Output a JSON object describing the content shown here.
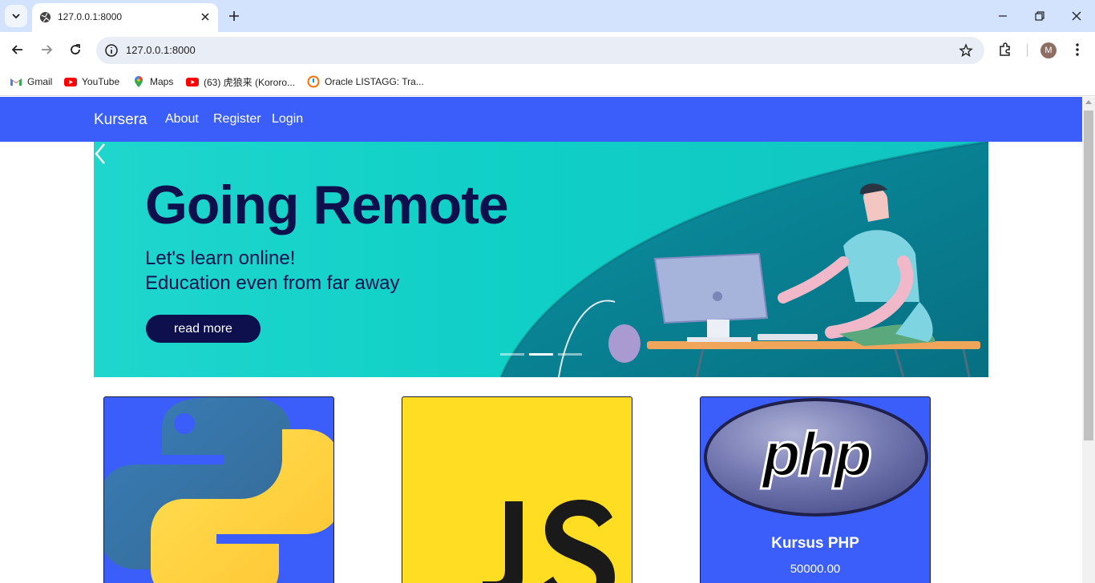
{
  "browser": {
    "tab_title": "127.0.0.1:8000",
    "url": "127.0.0.1:8000",
    "profile_initial": "M",
    "bookmarks": [
      {
        "label": "Gmail",
        "icon": "gmail-icon"
      },
      {
        "label": "YouTube",
        "icon": "youtube-icon"
      },
      {
        "label": "Maps",
        "icon": "maps-icon"
      },
      {
        "label": "(63) 虎狼来 (Kororo...",
        "icon": "youtube-icon"
      },
      {
        "label": "Oracle LISTAGG: Tra...",
        "icon": "oracle-icon"
      }
    ]
  },
  "site": {
    "brand": "Kursera",
    "nav": [
      "About",
      "Register",
      "Login"
    ],
    "accent_color": "#3b5efb"
  },
  "carousel": {
    "title": "Going Remote",
    "subtitle_1": "Let's learn online!",
    "subtitle_2": "Education even from far away",
    "button_label": "read more",
    "active_indicator": 2,
    "indicator_count": 3
  },
  "cards": [
    {
      "name": "python",
      "title": "",
      "price": "",
      "image": "python-logo",
      "bg": "#3b5efb"
    },
    {
      "name": "javascript",
      "title": "",
      "price": "",
      "image": "js-logo",
      "bg": "#ffdd23"
    },
    {
      "name": "php",
      "title": "Kursus PHP",
      "price": "50000.00",
      "image": "php-logo",
      "bg": "#3b5efb"
    }
  ]
}
